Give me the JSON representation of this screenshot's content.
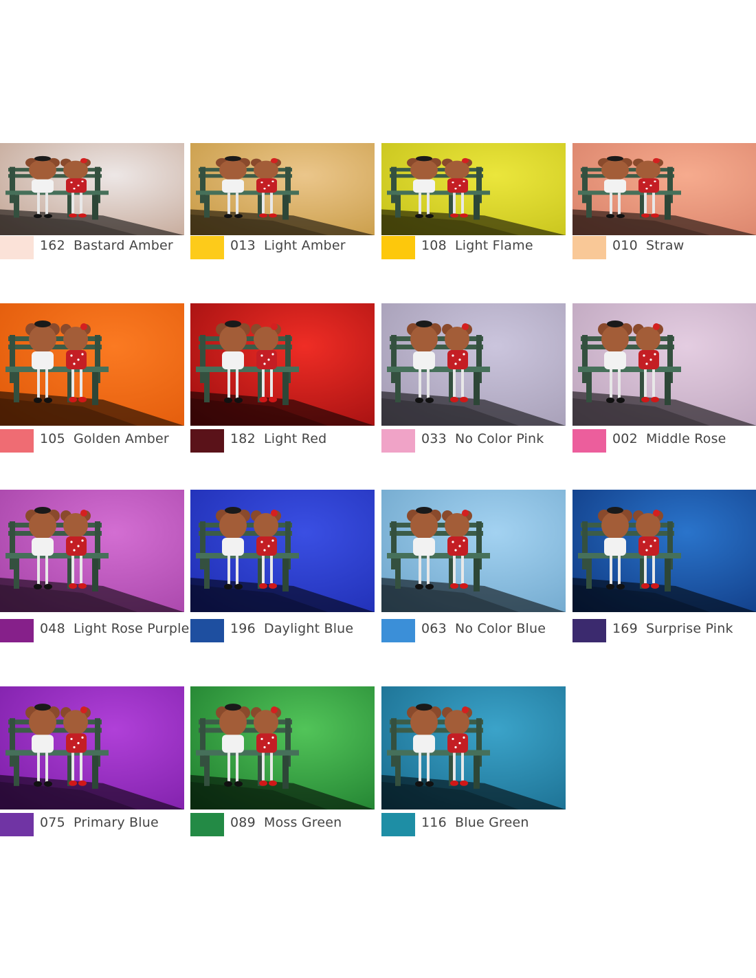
{
  "filters": [
    {
      "code": "162",
      "name": "Bastard Amber",
      "swatch": "#fbe2d8",
      "bg_light": "#ede7e6",
      "bg_dark": "#c3a594"
    },
    {
      "code": "013",
      "name": "Light Amber",
      "swatch": "#fdcb1a",
      "bg_light": "#ebc68b",
      "bg_dark": "#c79a44"
    },
    {
      "code": "108",
      "name": "Light Flame",
      "swatch": "#fdc80c",
      "bg_light": "#ebe63c",
      "bg_dark": "#c6c21b"
    },
    {
      "code": "010",
      "name": "Straw",
      "swatch": "#f9c897",
      "bg_light": "#f6ab8e",
      "bg_dark": "#d9826a"
    },
    {
      "code": "105",
      "name": "Golden Amber",
      "swatch": "#ef6c73",
      "bg_light": "#fb7a22",
      "bg_dark": "#e15a0a"
    },
    {
      "code": "182",
      "name": "Light Red",
      "swatch": "#5a1219",
      "bg_light": "#ef2d25",
      "bg_dark": "#9f0f10"
    },
    {
      "code": "033",
      "name": "No Color Pink",
      "swatch": "#f0a3c7",
      "bg_light": "#cbc5dd",
      "bg_dark": "#a49cb4"
    },
    {
      "code": "002",
      "name": "Middle Rose",
      "swatch": "#ec5e9c",
      "bg_light": "#e4cde1",
      "bg_dark": "#bda5bd"
    },
    {
      "code": "048",
      "name": "Light Rose Purple",
      "swatch": "#86208a",
      "bg_light": "#d36ed2",
      "bg_dark": "#a644a8"
    },
    {
      "code": "196",
      "name": "Daylight Blue",
      "swatch": "#1e4fa0",
      "bg_light": "#3a4fe3",
      "bg_dark": "#1f2eb3"
    },
    {
      "code": "063",
      "name": "No Color Blue",
      "swatch": "#3b8fd8",
      "bg_light": "#a3d2f1",
      "bg_dark": "#6fa6cb"
    },
    {
      "code": "169",
      "name": "Surprise Pink",
      "swatch": "#3b2a6e",
      "bg_light": "#2a74cb",
      "bg_dark": "#103a83"
    },
    {
      "code": "075",
      "name": "Primary Blue",
      "swatch": "#7034a4",
      "bg_light": "#b040d8",
      "bg_dark": "#7d1fa8"
    },
    {
      "code": "089",
      "name": "Moss Green",
      "swatch": "#238a45",
      "bg_light": "#52c459",
      "bg_dark": "#1f7e2f"
    },
    {
      "code": "116",
      "name": "Blue Green",
      "swatch": "#1e8ea5",
      "bg_light": "#3ba3c9",
      "bg_dark": "#1a6d8f"
    }
  ]
}
